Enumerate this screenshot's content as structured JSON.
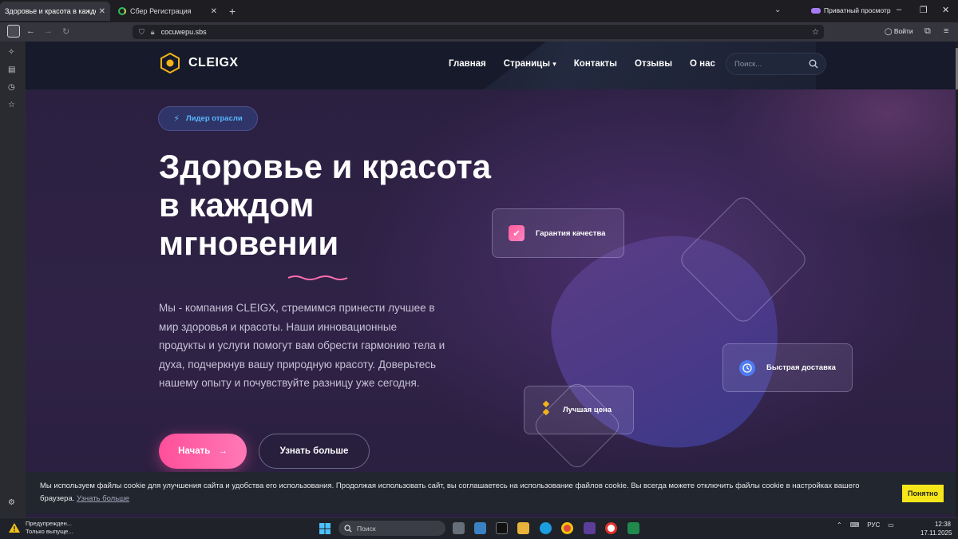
{
  "browser": {
    "tabs": [
      {
        "title": "Здоровье и красота в каждом мгновении",
        "active": true
      },
      {
        "title": "Сбер Регистрация",
        "active": false
      }
    ],
    "new_tab": "+",
    "private_label": "Приватный просмотр",
    "url": "cocuwepu.sbs",
    "login_label": "Войти"
  },
  "site": {
    "logo_text": "CLEIGX",
    "nav": {
      "home": "Главная",
      "pages": "Страницы",
      "contacts": "Контакты",
      "reviews": "Отзывы",
      "about": "О нас"
    },
    "search_placeholder": "Поиск...",
    "badge": "Лидер отрасли",
    "hero_title": "Здоровье и красота в каждом мгновении",
    "hero_text": "Мы - компания CLEIGX, стремимся принести лучшее в мир здоровья и красоты. Наши инновационные продукты и услуги помогут вам обрести гармонию тела и духа, подчеркнув вашу природную красоту. Доверьтесь нашему опыту и почувствуйте разницу уже сегодня.",
    "btn_start": "Начать",
    "btn_more": "Узнать больше",
    "features": {
      "quality": "Гарантия качества",
      "delivery": "Быстрая доставка",
      "price": "Лучшая цена"
    },
    "cookie": {
      "text": "Мы используем файлы cookie для улучшения сайта и удобства его использования. Продолжая использовать сайт, вы соглашаетесь на использование файлов cookie. Вы всегда можете отключить файлы cookie в настройках вашего браузера.",
      "link": "Узнать больше",
      "button": "Понятно"
    }
  },
  "taskbar": {
    "warning_line1": "Предупрежден...",
    "warning_line2": "Только выпуще...",
    "search_placeholder": "Поиск",
    "lang": "РУС",
    "time": "12:38",
    "date": "17.11.2025"
  },
  "colors": {
    "accent_pink": "#ff4f9a",
    "badge_text": "#59b7ff",
    "cookie_button": "#f5e61a",
    "logo_yellow": "#f2b31b"
  }
}
